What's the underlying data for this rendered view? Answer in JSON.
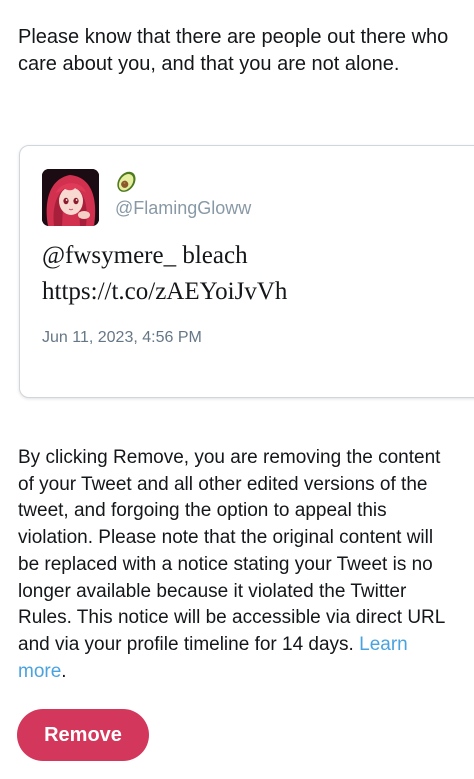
{
  "intro": {
    "text": "Please know that there are people out there who care about you, and that you are not alone."
  },
  "tweet": {
    "avatar": "avatar-anime-character",
    "display_name_icon": "avocado-emoji",
    "handle": "@FlamingGloww",
    "text_line1": "@fwsymere_ bleach",
    "text_line2": "https://t.co/zAEYoiJvVh",
    "timestamp": "Jun 11, 2023, 4:56 PM"
  },
  "info": {
    "text": "By clicking Remove, you are removing the content of your Tweet and all other edited versions of the tweet, and forgoing the option to appeal this violation. Please note that the original content will be replaced with a notice stating your Tweet is no longer available because it violated the Twitter Rules. This notice will be accessible via direct URL and via your profile timeline for 14 days.",
    "learn_more": "Learn more",
    "period": "."
  },
  "actions": {
    "remove_label": "Remove"
  },
  "colors": {
    "accent_button": "#d3375b",
    "link": "#4aa3df",
    "muted_text": "#8899a6"
  }
}
